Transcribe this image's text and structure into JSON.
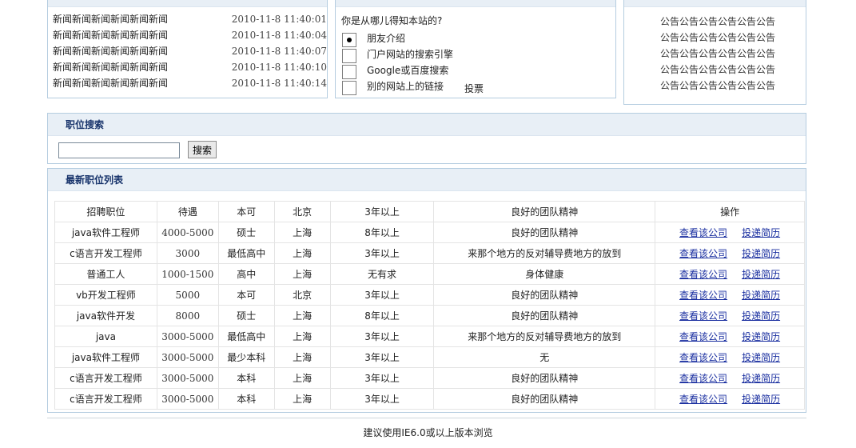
{
  "news": {
    "items": [
      {
        "title": "新闻新闻新闻新闻新闻新闻",
        "date": "2010-11-8 11:40:01"
      },
      {
        "title": "新闻新闻新闻新闻新闻新闻",
        "date": "2010-11-8 11:40:04"
      },
      {
        "title": "新闻新闻新闻新闻新闻新闻",
        "date": "2010-11-8 11:40:07"
      },
      {
        "title": "新闻新闻新闻新闻新闻新闻",
        "date": "2010-11-8 11:40:10"
      },
      {
        "title": "新闻新闻新闻新闻新闻新闻",
        "date": "2010-11-8 11:40:14"
      }
    ]
  },
  "survey": {
    "question": "你是从哪儿得知本站的?",
    "options": [
      "朋友介绍",
      "门户网站的搜索引擎",
      "Google或百度搜索",
      "别的网站上的链接"
    ],
    "selected": 0,
    "vote_label": "投票"
  },
  "notice": {
    "items": [
      "公告公告公告公告公告公告",
      "公告公告公告公告公告公告",
      "公告公告公告公告公告公告",
      "公告公告公告公告公告公告",
      "公告公告公告公告公告公告"
    ]
  },
  "search": {
    "title": "职位搜索",
    "input_value": "",
    "button_label": "搜索"
  },
  "jobs": {
    "title": "最新职位列表",
    "headers": [
      "招聘职位",
      "待遇",
      "本可",
      "北京",
      "3年以上",
      "良好的团队精神",
      "操作"
    ],
    "link_company": "查看该公司",
    "link_resume": "投递简历",
    "rows": [
      [
        "java软件工程师",
        "4000-5000",
        "硕士",
        "上海",
        "8年以上",
        "良好的团队精神"
      ],
      [
        "c语言开发工程师",
        "3000",
        "最低高中",
        "上海",
        "3年以上",
        "来那个地方的反对辅导费地方的放到"
      ],
      [
        "普通工人",
        "1000-1500",
        "高中",
        "上海",
        "无有求",
        "身体健康"
      ],
      [
        "vb开发工程师",
        "5000",
        "本可",
        "北京",
        "3年以上",
        "良好的团队精神"
      ],
      [
        "java软件开发",
        "8000",
        "硕士",
        "上海",
        "8年以上",
        "良好的团队精神"
      ],
      [
        "java",
        "3000-5000",
        "最低高中",
        "上海",
        "3年以上",
        "来那个地方的反对辅导费地方的放到"
      ],
      [
        "java软件工程师",
        "3000-5000",
        "最少本科",
        "上海",
        "3年以上",
        "无"
      ],
      [
        "c语言开发工程师",
        "3000-5000",
        "本科",
        "上海",
        "3年以上",
        "良好的团队精神"
      ],
      [
        "c语言开发工程师",
        "3000-5000",
        "本科",
        "上海",
        "3年以上",
        "良好的团队精神"
      ]
    ]
  },
  "footer": {
    "text": "建议使用IE6.0或以上版本浏览"
  }
}
